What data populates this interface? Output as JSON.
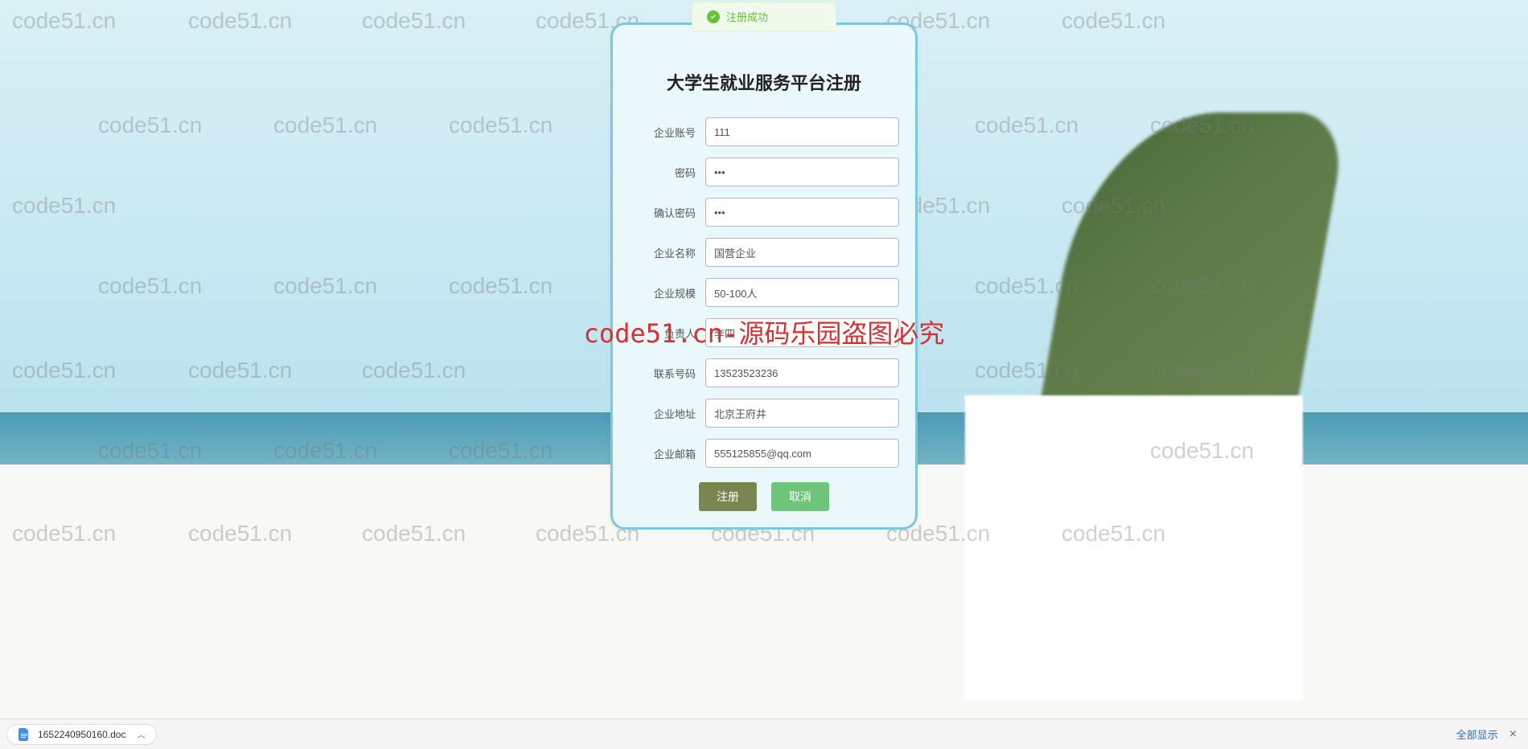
{
  "watermark_text": "code51.cn",
  "watermark_center": "code51.cn-源码乐园盗图必究",
  "toast": {
    "message": "注册成功"
  },
  "card": {
    "title": "大学生就业服务平台注册",
    "fields": {
      "account": {
        "label": "企业账号",
        "value": "111"
      },
      "password": {
        "label": "密码",
        "value": "123"
      },
      "confirm": {
        "label": "确认密码",
        "value": "123"
      },
      "name": {
        "label": "企业名称",
        "value": "国营企业"
      },
      "scale": {
        "label": "企业规模",
        "value": "50-100人"
      },
      "leader": {
        "label": "负责人",
        "value": "李四"
      },
      "phone": {
        "label": "联系号码",
        "value": "13523523236"
      },
      "address": {
        "label": "企业地址",
        "value": "北京王府井"
      },
      "email": {
        "label": "企业邮箱",
        "value": "555125855@qq.com"
      }
    },
    "buttons": {
      "submit": "注册",
      "cancel": "取消"
    }
  },
  "download_bar": {
    "filename": "1652240950160.doc",
    "show_all": "全部显示",
    "close": "×"
  }
}
